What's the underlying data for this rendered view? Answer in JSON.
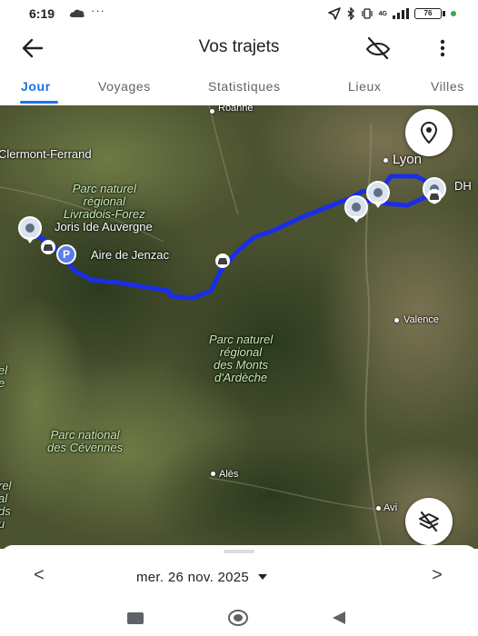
{
  "status_bar": {
    "time": "6:19",
    "overflow": "···",
    "network": "4G",
    "battery": "76"
  },
  "app_bar": {
    "title": "Vos trajets",
    "icons": {
      "back": "arrow-left-icon",
      "location_off": "location-off-icon",
      "more": "more-vert-icon"
    }
  },
  "tabs": [
    {
      "label": "Jour",
      "active": true
    },
    {
      "label": "Voyages",
      "active": false
    },
    {
      "label": "Statistiques",
      "active": false
    },
    {
      "label": "Lieux",
      "active": false
    },
    {
      "label": "Villes",
      "active": false
    }
  ],
  "map": {
    "places": {
      "roanne": "Roanne",
      "clermont": "Clermont-Ferrand",
      "lyon": "Lyon",
      "dh": "DH",
      "valence": "Valence",
      "ales": "Alès",
      "avignon": "Avi"
    },
    "parks": {
      "livradois": "Parc naturel\nrégional\nLivradois-Forez",
      "ardeche": "Parc naturel\nrégional\ndes Monts\nd'Ardèche",
      "cevennes": "Parc national\ndes Cévennes"
    },
    "edge_fragments": {
      "left_1": "el\ne",
      "left_2": "rel\nal\nds\nu"
    },
    "visit_labels": {
      "joris": "Joris Ide Auvergne",
      "jenzac": "Aire de Jenzac"
    },
    "parking_glyph": "P",
    "route_color": "#1a2ee8",
    "icons": {
      "locate": "location-pin-icon",
      "layers_off": "layers-off-icon"
    }
  },
  "date_nav": {
    "prev": "<",
    "date": "mer. 26 nov. 2025",
    "next": ">"
  },
  "nav_bar": {
    "icons": {
      "recent": "recent-apps-icon",
      "home": "home-icon",
      "back": "back-triangle-icon"
    }
  },
  "colors": {
    "accent": "#1a73e8",
    "route": "#1a2ee8",
    "text": "#202124",
    "park_label": "#c7ecb5"
  }
}
